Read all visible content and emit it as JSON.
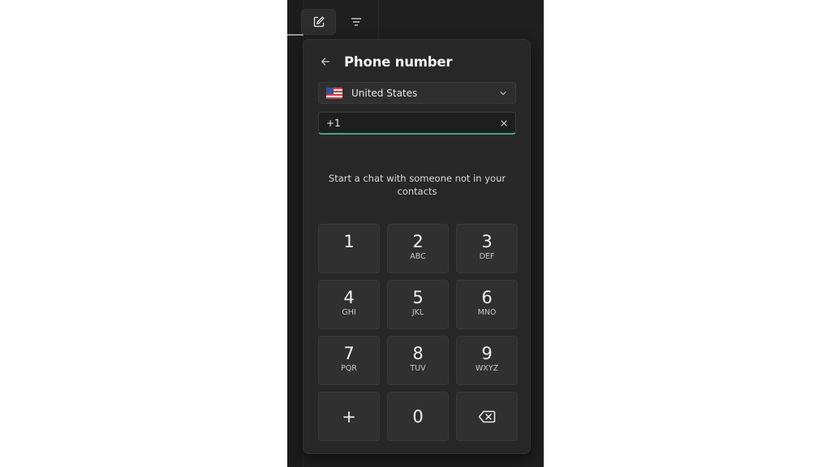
{
  "toolbar": {
    "new_chat_icon": "compose-icon",
    "filter_icon": "filter-icon"
  },
  "panel": {
    "title": "Phone number",
    "back_icon": "arrow-left-icon",
    "country": {
      "flag_icon": "us-flag-icon",
      "selected": "United States",
      "chevron_icon": "chevron-down-icon"
    },
    "phone_input": {
      "value": "+1",
      "clear_icon": "close-icon"
    },
    "hint": "Start a chat with someone not in your contacts",
    "keypad": [
      {
        "digit": "1",
        "letters": ""
      },
      {
        "digit": "2",
        "letters": "ABC"
      },
      {
        "digit": "3",
        "letters": "DEF"
      },
      {
        "digit": "4",
        "letters": "GHI"
      },
      {
        "digit": "5",
        "letters": "JKL"
      },
      {
        "digit": "6",
        "letters": "MNO"
      },
      {
        "digit": "7",
        "letters": "PQR"
      },
      {
        "digit": "8",
        "letters": "TUV"
      },
      {
        "digit": "9",
        "letters": "WXYZ"
      },
      {
        "digit": "+",
        "letters": ""
      },
      {
        "digit": "0",
        "letters": ""
      },
      {
        "digit": "",
        "letters": "",
        "icon": "backspace-icon"
      }
    ]
  },
  "colors": {
    "accent": "#4aa57d",
    "background": "#1f1f1f",
    "panel": "#272727",
    "key": "#303030"
  }
}
